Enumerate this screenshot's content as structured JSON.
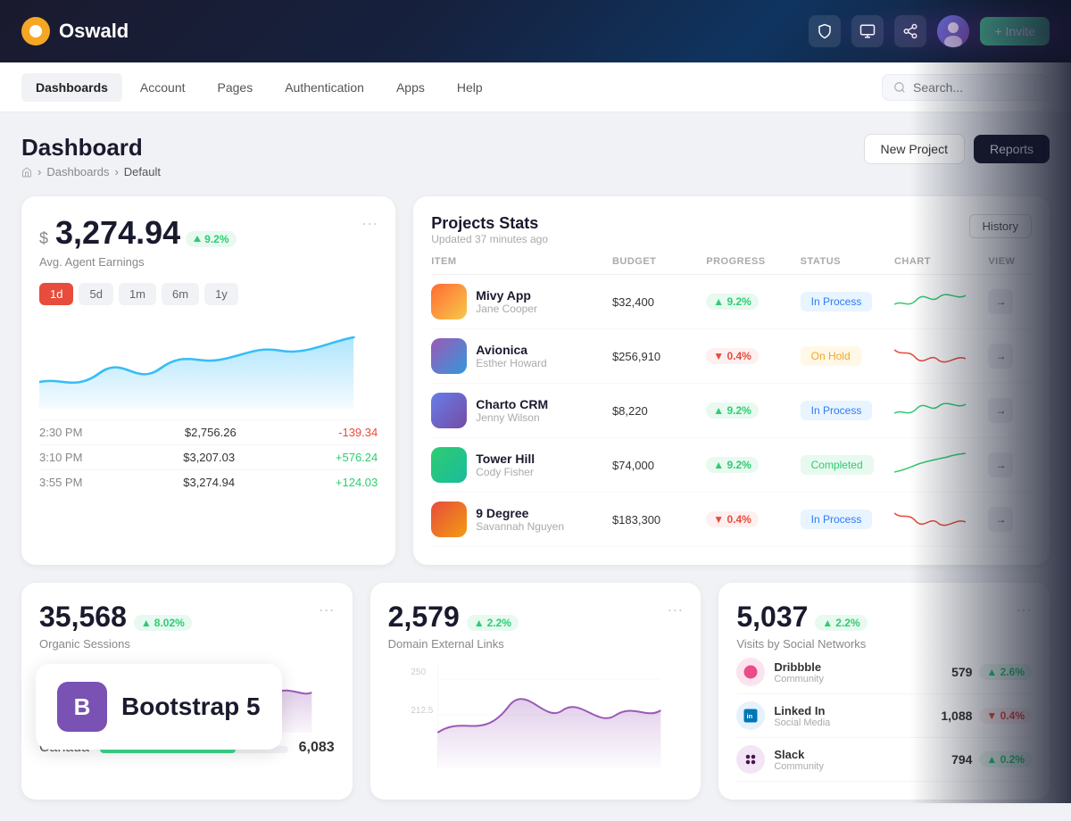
{
  "topbar": {
    "brand": "Oswald",
    "invite_label": "+ Invite"
  },
  "secondnav": {
    "items": [
      {
        "label": "Dashboards",
        "active": true
      },
      {
        "label": "Account",
        "active": false
      },
      {
        "label": "Pages",
        "active": false
      },
      {
        "label": "Authentication",
        "active": false
      },
      {
        "label": "Apps",
        "active": false
      },
      {
        "label": "Help",
        "active": false
      }
    ],
    "search_placeholder": "Search..."
  },
  "page": {
    "title": "Dashboard",
    "breadcrumb": [
      "Dashboards",
      "Default"
    ],
    "btn_new_project": "New Project",
    "btn_reports": "Reports"
  },
  "earnings": {
    "dollar": "$",
    "amount": "3,274.94",
    "badge": "9.2%",
    "label": "Avg. Agent Earnings",
    "time_filters": [
      "1d",
      "5d",
      "1m",
      "6m",
      "1y"
    ],
    "active_filter": "1d",
    "rows": [
      {
        "time": "2:30 PM",
        "amount": "$2,756.26",
        "change": "-139.34",
        "pos": false
      },
      {
        "time": "3:10 PM",
        "amount": "$3,207.03",
        "change": "+576.24",
        "pos": true
      },
      {
        "time": "3:55 PM",
        "amount": "$3,274.94",
        "change": "+124.03",
        "pos": true
      }
    ]
  },
  "projects": {
    "title": "Projects Stats",
    "updated": "Updated 37 minutes ago",
    "btn_history": "History",
    "columns": [
      "ITEM",
      "BUDGET",
      "PROGRESS",
      "STATUS",
      "CHART",
      "VIEW"
    ],
    "rows": [
      {
        "name": "Mivy App",
        "sub": "Jane Cooper",
        "budget": "$32,400",
        "progress": "9.2%",
        "progress_pos": true,
        "status": "In Process",
        "status_type": "inprocess",
        "color": "#ff6b35"
      },
      {
        "name": "Avionica",
        "sub": "Esther Howard",
        "budget": "$256,910",
        "progress": "0.4%",
        "progress_pos": false,
        "status": "On Hold",
        "status_type": "onhold",
        "color": "#9b59b6"
      },
      {
        "name": "Charto CRM",
        "sub": "Jenny Wilson",
        "budget": "$8,220",
        "progress": "9.2%",
        "progress_pos": true,
        "status": "In Process",
        "status_type": "inprocess",
        "color": "#3498db"
      },
      {
        "name": "Tower Hill",
        "sub": "Cody Fisher",
        "budget": "$74,000",
        "progress": "9.2%",
        "progress_pos": true,
        "status": "Completed",
        "status_type": "completed",
        "color": "#2ecc71"
      },
      {
        "name": "9 Degree",
        "sub": "Savannah Nguyen",
        "budget": "$183,300",
        "progress": "0.4%",
        "progress_pos": false,
        "status": "In Process",
        "status_type": "inprocess",
        "color": "#e74c3c"
      }
    ]
  },
  "organic": {
    "number": "35,568",
    "badge": "8.02%",
    "label": "Organic Sessions"
  },
  "external": {
    "number": "2,579",
    "badge": "2.2%",
    "label": "Domain External Links"
  },
  "social": {
    "number": "5,037",
    "badge": "2.2%",
    "label": "Visits by Social Networks",
    "items": [
      {
        "name": "Dribbble",
        "type": "Community",
        "count": "579",
        "change": "2.6%",
        "pos": true,
        "color": "#ea4c89"
      },
      {
        "name": "Linked In",
        "type": "Social Media",
        "count": "1,088",
        "change": "0.4%",
        "pos": false,
        "color": "#0077b5"
      },
      {
        "name": "Slack",
        "type": "Community",
        "count": "794",
        "change": "0.2%",
        "pos": true,
        "color": "#4a154b"
      }
    ]
  },
  "map": {
    "rows": [
      {
        "country": "Canada",
        "value": "6,083",
        "pct": 72
      }
    ]
  },
  "bootstrap": {
    "label": "Bootstrap 5",
    "logo": "B"
  }
}
